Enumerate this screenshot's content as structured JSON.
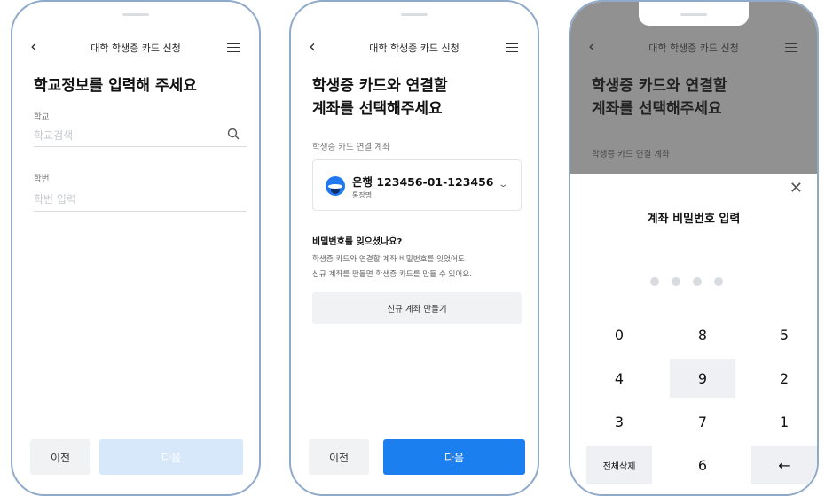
{
  "screen1": {
    "title": "대학 학생증 카드 신청",
    "heading": "학교정보를 입력해 주세요",
    "school_label": "학교",
    "school_placeholder": "학교검색",
    "student_no_label": "학번",
    "student_no_placeholder": "학번 입력",
    "prev_label": "이전",
    "next_label": "다음"
  },
  "screen2": {
    "title": "대학 학생증 카드 신청",
    "heading_line1": "학생증 카드와 연결할",
    "heading_line2": "계좌를 선택해주세요",
    "account_label": "학생증 카드 연결 계좌",
    "account_number": "은행 123456-01-123456",
    "account_type": "통장명",
    "forgot_title": "비밀번호를 잊으셨나요?",
    "forgot_line1": "학생증 카드와 연결할 계좌 비밀번호를 잊었어도",
    "forgot_line2": "신규 계좌를 만들면 학생증 카드를 만들 수 있어요.",
    "new_account_label": "신규 계좌 만들기",
    "prev_label": "이전",
    "next_label": "다음"
  },
  "screen3": {
    "title": "대학 학생증 카드 신청",
    "heading_line1": "학생증 카드와 연결할",
    "heading_line2": "계좌를 선택해주세요",
    "account_label": "학생증 카드 연결 계좌",
    "sheet_title": "계좌 비밀번호 입력",
    "pin_length": 4,
    "pin_filled": 0,
    "keypad": [
      "0",
      "8",
      "5",
      "4",
      "9",
      "2",
      "3",
      "7",
      "1",
      "전체삭제",
      "6",
      "←"
    ],
    "pressed_key": "9"
  },
  "icons": {
    "back": "back-arrow-icon",
    "menu": "hamburger-menu-icon",
    "search": "search-icon",
    "chevron": "chevron-down-icon",
    "close": "close-icon",
    "backspace": "backspace-arrow-icon"
  },
  "colors": {
    "primary": "#1c7ff0",
    "primary_disabled": "#d7e8fb",
    "frame": "#8fa9c9",
    "overlay": "#919191"
  }
}
